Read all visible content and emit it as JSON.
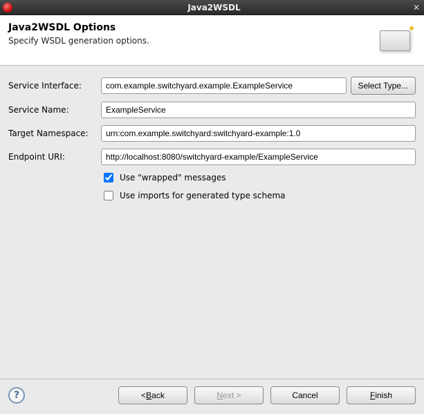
{
  "titlebar": {
    "title": "Java2WSDL"
  },
  "header": {
    "heading": "Java2WSDL Options",
    "subheading": "Specify WSDL generation options."
  },
  "form": {
    "serviceInterface": {
      "label": "Service Interface:",
      "value": "com.example.switchyard.example.ExampleService"
    },
    "selectType": {
      "label": "Select Type..."
    },
    "serviceName": {
      "label": "Service Name:",
      "value": "ExampleService"
    },
    "targetNamespace": {
      "label": "Target Namespace:",
      "value": "urn:com.example.switchyard:switchyard-example:1.0"
    },
    "endpointUri": {
      "label": "Endpoint URI:",
      "value": "http://localhost:8080/switchyard-example/ExampleService"
    },
    "useWrapped": {
      "label": "Use \"wrapped\" messages",
      "checked": true
    },
    "useImports": {
      "label": "Use imports for generated type schema",
      "checked": false
    }
  },
  "footer": {
    "back": {
      "prefix": "< ",
      "mn": "B",
      "suffix": "ack"
    },
    "next": {
      "mn": "N",
      "suffix": "ext >"
    },
    "cancel": {
      "label": "Cancel"
    },
    "finish": {
      "mn": "F",
      "suffix": "inish"
    }
  }
}
